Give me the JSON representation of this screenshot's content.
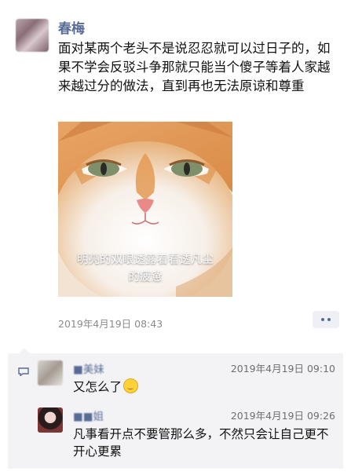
{
  "post": {
    "author": "春梅",
    "text": "面对某两个老头不是说忍忍就可以过日子的，如果不学会反驳斗争那就只能当个傻子等着人家越来越过分的做法，直到再也无法原谅和尊重",
    "image_caption_line1": "明亮的双眼透露着看透凡尘",
    "image_caption_line2": "的疲惫",
    "timestamp": "2019年4月19日 08:43"
  },
  "comments": [
    {
      "name": "■美妹",
      "time": "2019年4月19日 09:10",
      "text": "又怎么了",
      "emoji": "woozy-face-emoji"
    },
    {
      "name": "■■姐",
      "time": "2019年4月19日 09:26",
      "text": "凡事看开点不要管那么多，不然只会让自己更不开心更累"
    }
  ],
  "colors": {
    "link_blue": "#576b95",
    "comment_bg": "#f3f3f5",
    "meta_gray": "#8a8a8a"
  }
}
